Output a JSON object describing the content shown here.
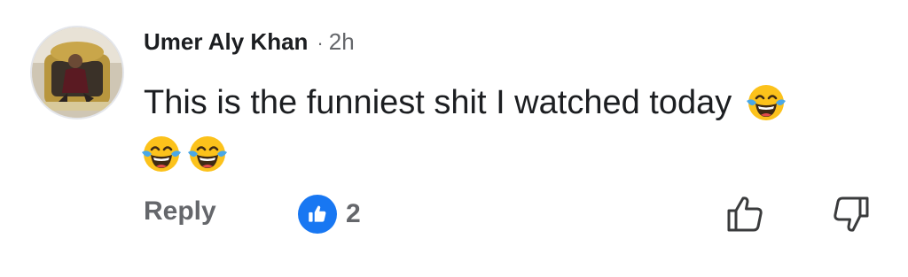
{
  "comment": {
    "author": "Umer Aly Khan",
    "separator": "·",
    "timestamp": "2h",
    "text": "This is the funniest shit I watched today",
    "emojis": [
      "face-with-tears-of-joy-icon",
      "face-with-tears-of-joy-icon",
      "face-with-tears-of-joy-icon"
    ]
  },
  "actions": {
    "reply_label": "Reply",
    "reaction_icon": "like-icon",
    "reaction_count": "2",
    "upvote_icon": "thumbs-up-outline-icon",
    "downvote_icon": "thumbs-down-outline-icon"
  },
  "colors": {
    "text": "#1c1e21",
    "secondary_text": "#65676b",
    "like_blue": "#1877f2"
  }
}
